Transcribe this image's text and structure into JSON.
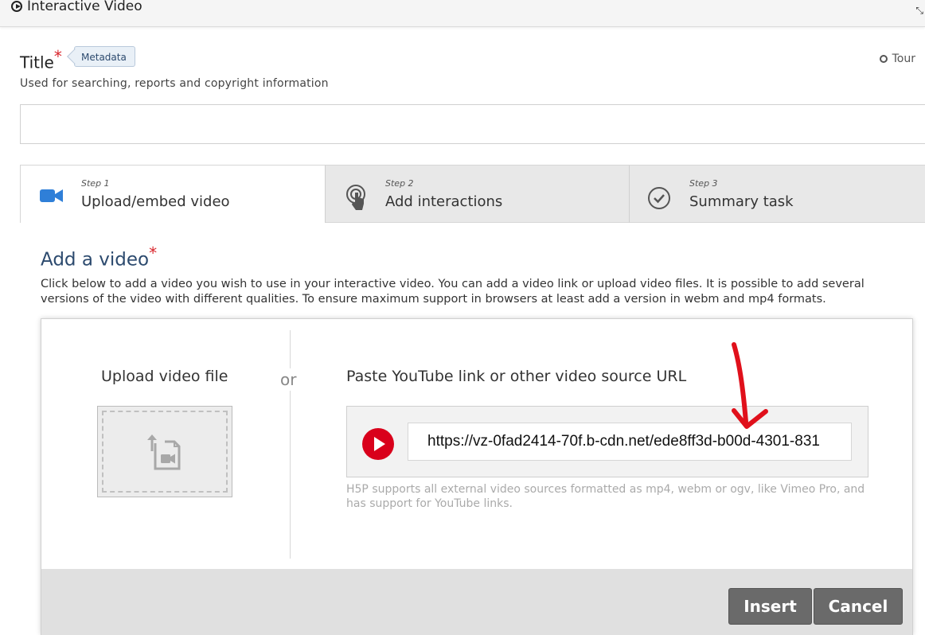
{
  "app": {
    "title": "Interactive Video"
  },
  "header": {
    "title_label": "Title",
    "required_mark": "*",
    "metadata_label": "Metadata",
    "tour_label": "Tour",
    "description": "Used for searching, reports and copyright information",
    "title_value": ""
  },
  "tabs": [
    {
      "step": "Step 1",
      "label": "Upload/embed video",
      "active": true,
      "icon": "video-camera-icon"
    },
    {
      "step": "Step 2",
      "label": "Add interactions",
      "active": false,
      "icon": "touch-icon"
    },
    {
      "step": "Step 3",
      "label": "Summary task",
      "active": false,
      "icon": "check-circle-icon"
    }
  ],
  "add_video": {
    "title": "Add a video",
    "required_mark": "*",
    "description": "Click below to add a video you wish to use in your interactive video. You can add a video link or upload video files. It is possible to add several versions of the video with different qualities. To ensure maximum support in browsers at least add a version in webm and mp4 formats."
  },
  "dialog": {
    "upload_label": "Upload video file",
    "or_label": "or",
    "paste_label": "Paste YouTube link or other video source URL",
    "url_value": "https://vz-0fad2414-70f.b-cdn.net/ede8ff3d-b00d-4301-831",
    "hint": "H5P supports all external video sources formatted as mp4, webm or ogv, like Vimeo Pro, and has support for YouTube links.",
    "insert_label": "Insert",
    "cancel_label": "Cancel"
  },
  "colors": {
    "accent": "#2c4a6e",
    "tab_icon_active": "#2f7fd8",
    "required": "#d9262d",
    "youtube": "#d9001b",
    "annotation_arrow": "#e0101b"
  }
}
